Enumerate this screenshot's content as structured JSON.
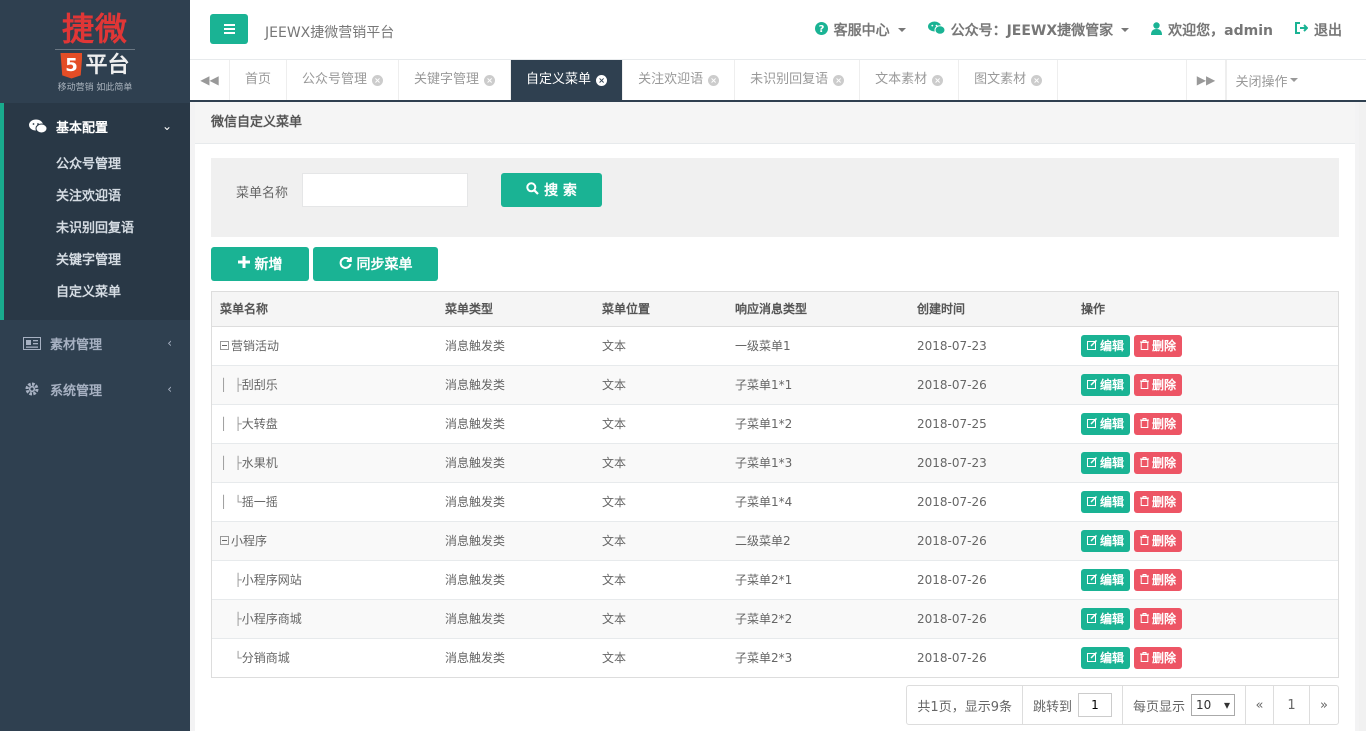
{
  "app": {
    "logo_text": "捷微",
    "logo_badge": "5",
    "logo_platform": "平台",
    "logo_slogan": "移动营销 如此简单",
    "site_title": "JEEWX捷微营销平台"
  },
  "topbar": {
    "service": "客服中心",
    "account": "公众号：JEEWX捷微管家",
    "welcome": "欢迎您，admin",
    "logout": "退出"
  },
  "sidebar": {
    "groups": [
      {
        "label": "基本配置",
        "icon": "wechat-icon",
        "arrow": "⌄",
        "items": [
          "公众号管理",
          "关注欢迎语",
          "未识别回复语",
          "关键字管理",
          "自定义菜单"
        ]
      },
      {
        "label": "素材管理",
        "icon": "newspaper-icon",
        "arrow": "‹"
      },
      {
        "label": "系统管理",
        "icon": "gear-icon",
        "arrow": "‹"
      }
    ]
  },
  "tabs": {
    "items": [
      "首页",
      "公众号管理",
      "关键字管理",
      "自定义菜单",
      "关注欢迎语",
      "未识别回复语",
      "文本素材",
      "图文素材"
    ],
    "active_index": 3,
    "close_ops": "关闭操作"
  },
  "page": {
    "title": "微信自定义菜单",
    "search_label": "菜单名称",
    "search_value": "",
    "search_button": "搜 索",
    "add_button": "新增",
    "sync_button": "同步菜单"
  },
  "table": {
    "headers": [
      "菜单名称",
      "菜单类型",
      "菜单位置",
      "响应消息类型",
      "创建时间",
      "操作"
    ],
    "rows": [
      {
        "guide": "",
        "root": true,
        "name": "营销活动",
        "type": "消息触发类",
        "pos": "文本",
        "resp": "一级菜单1",
        "date": "2018-07-23"
      },
      {
        "guide": "│ ├",
        "root": false,
        "name": "刮刮乐",
        "type": "消息触发类",
        "pos": "文本",
        "resp": "子菜单1*1",
        "date": "2018-07-26"
      },
      {
        "guide": "│ ├",
        "root": false,
        "name": "大转盘",
        "type": "消息触发类",
        "pos": "文本",
        "resp": "子菜单1*2",
        "date": "2018-07-25"
      },
      {
        "guide": "│ ├",
        "root": false,
        "name": "水果机",
        "type": "消息触发类",
        "pos": "文本",
        "resp": "子菜单1*3",
        "date": "2018-07-23"
      },
      {
        "guide": "│ └",
        "root": false,
        "name": "摇一摇",
        "type": "消息触发类",
        "pos": "文本",
        "resp": "子菜单1*4",
        "date": "2018-07-26"
      },
      {
        "guide": "",
        "root": true,
        "name": "小程序",
        "type": "消息触发类",
        "pos": "文本",
        "resp": "二级菜单2",
        "date": "2018-07-26"
      },
      {
        "guide": "  ├",
        "root": false,
        "name": "小程序网站",
        "type": "消息触发类",
        "pos": "文本",
        "resp": "子菜单2*1",
        "date": "2018-07-26"
      },
      {
        "guide": "  ├",
        "root": false,
        "name": "小程序商城",
        "type": "消息触发类",
        "pos": "文本",
        "resp": "子菜单2*2",
        "date": "2018-07-26"
      },
      {
        "guide": "  └",
        "root": false,
        "name": "分销商城",
        "type": "消息触发类",
        "pos": "文本",
        "resp": "子菜单2*3",
        "date": "2018-07-26"
      }
    ],
    "edit_label": "编辑",
    "delete_label": "删除"
  },
  "pager": {
    "summary": "共1页，显示9条",
    "jump_label": "跳转到",
    "jump_value": "1",
    "per_page_label": "每页显示",
    "per_page_value": "10",
    "prev": "«",
    "page": "1",
    "next": "»"
  },
  "colors": {
    "accent": "#1ab394",
    "sidebar_bg": "#2f4050",
    "danger": "#ed5565"
  }
}
